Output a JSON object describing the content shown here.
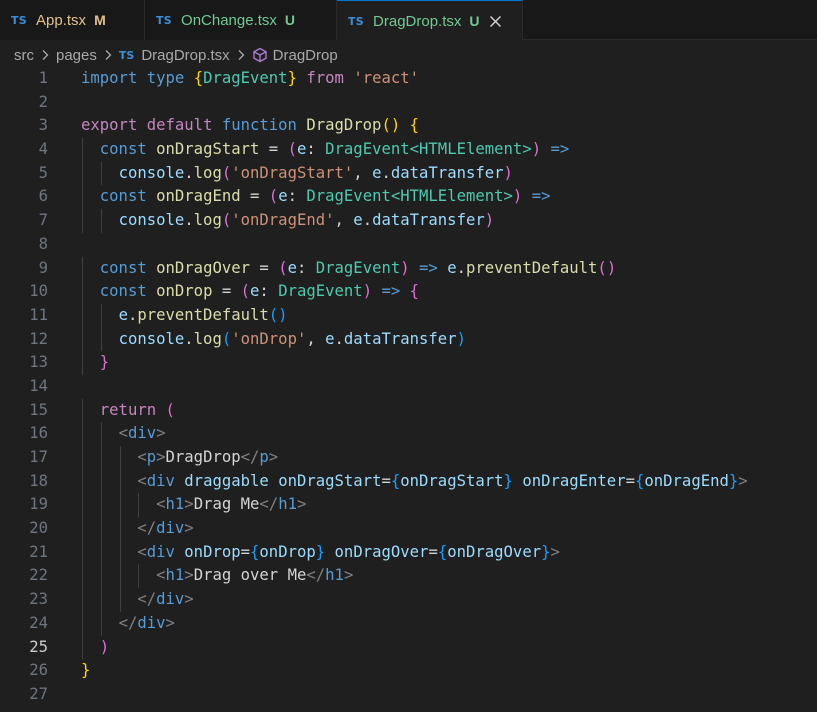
{
  "tabs": [
    {
      "icon": "TS",
      "name": "App.tsx",
      "status": "M",
      "name_color": "#e2c08d",
      "status_color": "#e2c08d"
    },
    {
      "icon": "TS",
      "name": "OnChange.tsx",
      "status": "U",
      "name_color": "#73c991",
      "status_color": "#73c991"
    },
    {
      "icon": "TS",
      "name": "DragDrop.tsx",
      "status": "U",
      "name_color": "#73c991",
      "status_color": "#73c991"
    }
  ],
  "breadcrumb": {
    "items": [
      "src",
      "pages",
      "DragDrop.tsx",
      "DragDrop"
    ],
    "file_icon": "TS"
  },
  "editor": {
    "current_line": 25,
    "lines": [
      {
        "n": "1",
        "text": "import type {DragEvent} from 'react'"
      },
      {
        "n": "2",
        "text": ""
      },
      {
        "n": "3",
        "text": "export default function DragDrop() {"
      },
      {
        "n": "4",
        "text": "  const onDragStart = (e: DragEvent<HTMLElement>) =>"
      },
      {
        "n": "5",
        "text": "    console.log('onDragStart', e.dataTransfer)"
      },
      {
        "n": "6",
        "text": "  const onDragEnd = (e: DragEvent<HTMLElement>) =>"
      },
      {
        "n": "7",
        "text": "    console.log('onDragEnd', e.dataTransfer)"
      },
      {
        "n": "8",
        "text": ""
      },
      {
        "n": "9",
        "text": "  const onDragOver = (e: DragEvent) => e.preventDefault()"
      },
      {
        "n": "10",
        "text": "  const onDrop = (e: DragEvent) => {"
      },
      {
        "n": "11",
        "text": "    e.preventDefault()"
      },
      {
        "n": "12",
        "text": "    console.log('onDrop', e.dataTransfer)"
      },
      {
        "n": "13",
        "text": "  }"
      },
      {
        "n": "14",
        "text": ""
      },
      {
        "n": "15",
        "text": "  return ("
      },
      {
        "n": "16",
        "text": "    <div>"
      },
      {
        "n": "17",
        "text": "      <p>DragDrop</p>"
      },
      {
        "n": "18",
        "text": "      <div draggable onDragStart={onDragStart} onDragEnter={onDragEnd}>"
      },
      {
        "n": "19",
        "text": "        <h1>Drag Me</h1>"
      },
      {
        "n": "20",
        "text": "      </div>"
      },
      {
        "n": "21",
        "text": "      <div onDrop={onDrop} onDragOver={onDragOver}>"
      },
      {
        "n": "22",
        "text": "        <h1>Drag over Me</h1>"
      },
      {
        "n": "23",
        "text": "      </div>"
      },
      {
        "n": "24",
        "text": "    </div>"
      },
      {
        "n": "25",
        "text": "  )"
      },
      {
        "n": "26",
        "text": "}"
      },
      {
        "n": "27",
        "text": ""
      }
    ]
  }
}
